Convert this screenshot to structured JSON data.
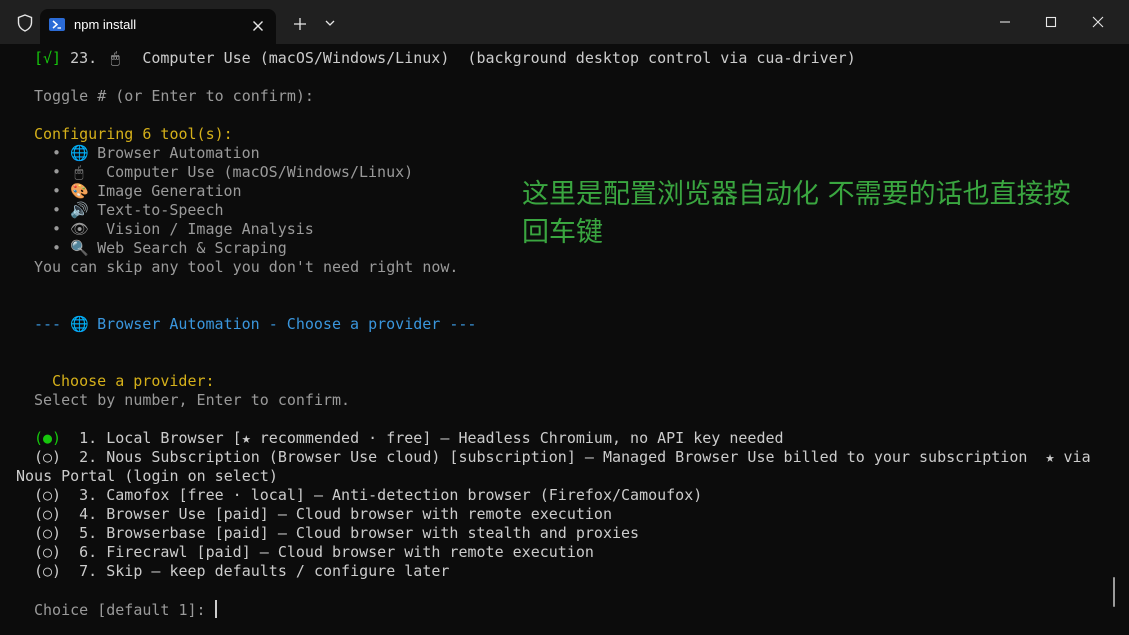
{
  "window": {
    "tab_title": "npm install",
    "icons": {
      "shield": "shield-icon",
      "terminal": "powershell-icon",
      "close": "close-icon",
      "new_tab": "plus-icon",
      "dropdown": "chevron-down-icon",
      "minimize": "minimize-icon",
      "maximize": "maximize-icon",
      "window_close": "close-icon"
    }
  },
  "terminal": {
    "completed_item": {
      "check": "[√]",
      "number": "23.",
      "icon": "🖱",
      "text": "Computer Use (macOS/Windows/Linux)  (background desktop control via cua-driver)"
    },
    "toggle_prompt": "Toggle # (or Enter to confirm):",
    "configuring_heading": "Configuring 6 tool(s):",
    "tools": [
      {
        "bullet": "•",
        "icon": "🌐",
        "label": "Browser Automation"
      },
      {
        "bullet": "•",
        "icon": "🖱",
        "label": " Computer Use (macOS/Windows/Linux)"
      },
      {
        "bullet": "•",
        "icon": "🎨",
        "label": "Image Generation"
      },
      {
        "bullet": "•",
        "icon": "🔊",
        "label": "Text-to-Speech"
      },
      {
        "bullet": "•",
        "icon": "👁",
        "label": " Vision / Image Analysis"
      },
      {
        "bullet": "•",
        "icon": "🔍",
        "label": "Web Search & Scraping"
      }
    ],
    "skip_note": "You can skip any tool you don't need right now.",
    "section_header": {
      "prefix": "--- ",
      "icon": "🌐",
      "text": " Browser Automation - Choose a provider ---"
    },
    "choose_heading": "Choose a provider:",
    "select_hint": "Select by number, Enter to confirm.",
    "options": [
      {
        "marker": "(●)",
        "text": "  1. Local Browser [★ recommended · free] — Headless Chromium, no API key needed"
      },
      {
        "marker": "(○)",
        "text": "  2. Nous Subscription (Browser Use cloud) [subscription] — Managed Browser Use billed to your subscription  ★ via"
      },
      {
        "marker": "",
        "text": "Nous Portal (login on select)"
      },
      {
        "marker": "(○)",
        "text": "  3. Camofox [free · local] — Anti-detection browser (Firefox/Camoufox)"
      },
      {
        "marker": "(○)",
        "text": "  4. Browser Use [paid] — Cloud browser with remote execution"
      },
      {
        "marker": "(○)",
        "text": "  5. Browserbase [paid] — Cloud browser with stealth and proxies"
      },
      {
        "marker": "(○)",
        "text": "  6. Firecrawl [paid] — Cloud browser with remote execution"
      },
      {
        "marker": "(○)",
        "text": "  7. Skip — keep defaults / configure later"
      }
    ],
    "choice_prompt": "Choice [default 1]: "
  },
  "annotation": {
    "line1": "这里是配置浏览器自动化 不需要的话也直接按",
    "line2": "回车键"
  },
  "colors": {
    "background": "#0c0c0c",
    "titlebar": "#202020",
    "text": "#cccccc",
    "dim": "#9a9a9a",
    "yellow": "#d5b01a",
    "green": "#16c60c",
    "blue": "#3a96dd",
    "annotation": "#3aa640"
  }
}
